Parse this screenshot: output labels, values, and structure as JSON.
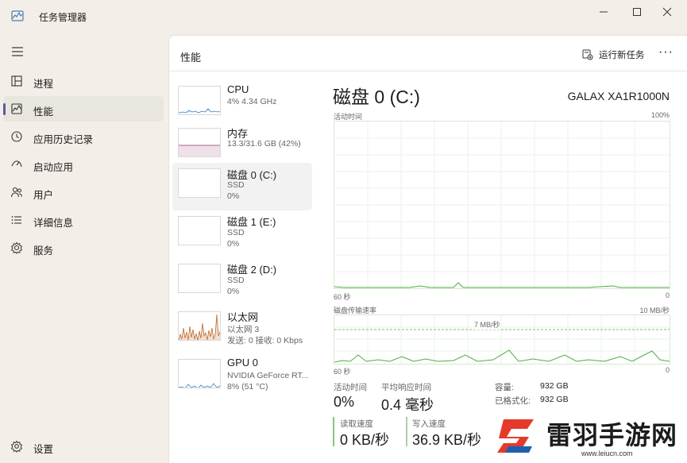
{
  "app": {
    "title": "任务管理器"
  },
  "sidebar": {
    "items": [
      {
        "label": "进程",
        "icon": "processes-icon"
      },
      {
        "label": "性能",
        "icon": "performance-icon",
        "active": true
      },
      {
        "label": "应用历史记录",
        "icon": "history-icon"
      },
      {
        "label": "启动应用",
        "icon": "startup-icon"
      },
      {
        "label": "用户",
        "icon": "users-icon"
      },
      {
        "label": "详细信息",
        "icon": "details-icon"
      },
      {
        "label": "服务",
        "icon": "services-icon"
      }
    ],
    "settings_label": "设置"
  },
  "header": {
    "title": "性能",
    "run_task_label": "运行新任务",
    "more_label": "···"
  },
  "devices": [
    {
      "name": "CPU",
      "sub1": "4% 4.34 GHz",
      "sub2": ""
    },
    {
      "name": "内存",
      "sub1": "13.3/31.6 GB (42%)",
      "sub2": ""
    },
    {
      "name": "磁盘 0 (C:)",
      "sub1": "SSD",
      "sub2": "0%",
      "active": true
    },
    {
      "name": "磁盘 1 (E:)",
      "sub1": "SSD",
      "sub2": "0%"
    },
    {
      "name": "磁盘 2 (D:)",
      "sub1": "SSD",
      "sub2": "0%"
    },
    {
      "name": "以太网",
      "sub1": "以太网 3",
      "sub2": "发送: 0 接收: 0 Kbps"
    },
    {
      "name": "GPU 0",
      "sub1": "NVIDIA GeForce RT...",
      "sub2": "8% (51 °C)"
    }
  ],
  "detail": {
    "title": "磁盘 0 (C:)",
    "model": "GALAX XA1R1000N",
    "active_time_label": "活动时间",
    "active_time_max": "100%",
    "axis_left": "60 秒",
    "axis_right": "0",
    "transfer_label": "磁盘传输速率",
    "transfer_max": "10 MB/秒",
    "transfer_mid": "7 MB/秒",
    "stats": {
      "active_time_label": "活动时间",
      "active_time_value": "0%",
      "response_label": "平均响应时间",
      "response_value": "0.4 毫秒",
      "read_label": "读取速度",
      "read_value": "0 KB/秒",
      "write_label": "写入速度",
      "write_value": "36.9 KB/秒"
    },
    "info": {
      "capacity_label": "容量:",
      "capacity_value": "932 GB",
      "formatted_label": "已格式化:",
      "formatted_value": "932 GB"
    }
  },
  "watermark": {
    "text": "雷羽手游网",
    "url": "www.leiucn.com"
  },
  "colors": {
    "disk_green": "#4caf3d",
    "cpu_blue": "#3b82c4",
    "mem_purple": "#8d3a6e",
    "eth_orange": "#c06a2a"
  }
}
